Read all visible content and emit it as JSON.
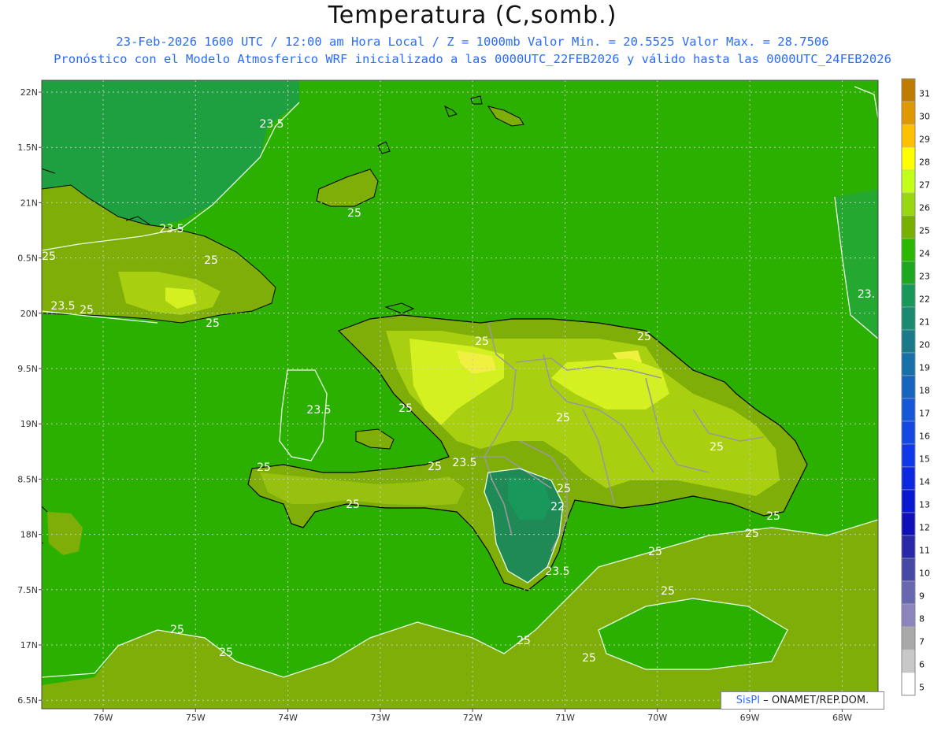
{
  "title": "Temperatura (C,somb.)",
  "subtitle_line1": "23-Feb-2026 1600 UTC / 12:00 am Hora Local / Z = 1000mb  Valor Min. = 20.5525  Valor Max. = 28.7506",
  "subtitle_line2": "Pronóstico con el Modelo Atmosferico WRF inicializado a las 0000UTC_22FEB2026 y válido hasta las  0000UTC_24FEB2026",
  "credit": {
    "brand": "SisPI",
    "text": " – ONAMET/REP.DOM."
  },
  "lat_labels": [
    "22N",
    "1.5N",
    "21N",
    "0.5N",
    "20N",
    "9.5N",
    "19N",
    "8.5N",
    "18N",
    "7.5N",
    "17N",
    "6.5N"
  ],
  "lon_labels": [
    "76W",
    "75W",
    "74W",
    "73W",
    "72W",
    "71W",
    "70W",
    "69W",
    "68W"
  ],
  "colorbar": {
    "labels": [
      "31",
      "30",
      "29",
      "28",
      "27",
      "26",
      "25",
      "24",
      "23",
      "22",
      "21",
      "20",
      "19",
      "18",
      "17",
      "16",
      "15",
      "14",
      "13",
      "12",
      "11",
      "10",
      "9",
      "8",
      "7",
      "6",
      "5"
    ],
    "colors": [
      "#c07c00",
      "#e09800",
      "#ffc000",
      "#ffff00",
      "#c4ff1a",
      "#98d810",
      "#78b000",
      "#2cb800",
      "#1ea820",
      "#18985a",
      "#1a8a70",
      "#1a7a8a",
      "#1870a8",
      "#1464c0",
      "#1458d8",
      "#1448e0",
      "#1038e8",
      "#0c28e0",
      "#0a18d0",
      "#1010b8",
      "#2828a8",
      "#4848a8",
      "#6868b0",
      "#8c84bc",
      "#a8a8a8",
      "#c8c8c8",
      "#ffffff"
    ]
  },
  "contour_labels": [
    "23.5",
    "23.5",
    "25",
    "25",
    "25",
    "23.5",
    "25",
    "25",
    "25",
    "23.5",
    "25",
    "25",
    "25",
    "25",
    "23.5",
    "25",
    "25",
    "25",
    "25",
    "22",
    "23.5",
    "25",
    "25",
    "25",
    "25",
    "25",
    "25",
    "25",
    "25",
    "23."
  ],
  "colors": {
    "sea": "#2cb000",
    "sea_cool": "#1fa040",
    "warm": "#7fae08",
    "warmer": "#a8d010",
    "hot": "#d4f020",
    "hottest": "#f0f040",
    "cool_valley": "#1f8a55",
    "contour": "#e8ffe8",
    "coast": "#000000",
    "border": "#999999",
    "grid": "#c8c8c8"
  }
}
